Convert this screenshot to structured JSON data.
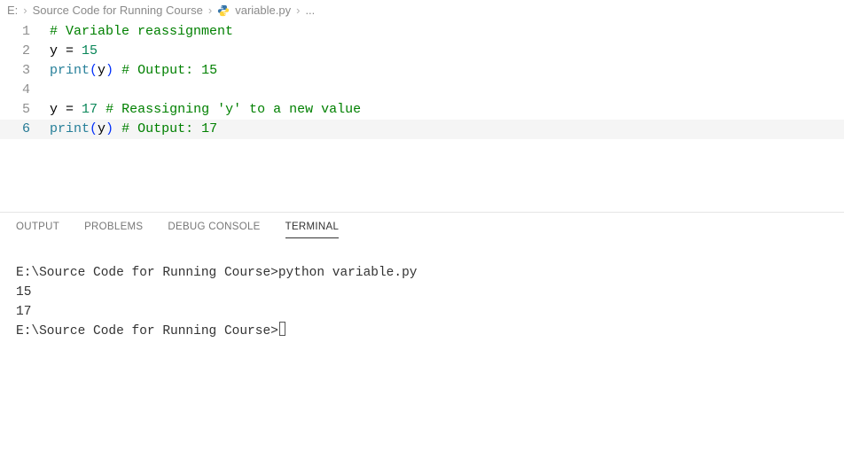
{
  "breadcrumb": {
    "root": "E:",
    "folder": "Source Code for Running Course",
    "file": "variable.py",
    "tail": "..."
  },
  "code": {
    "lines": [
      {
        "n": "1",
        "tokens": [
          [
            "comment",
            "# Variable reassignment"
          ]
        ]
      },
      {
        "n": "2",
        "tokens": [
          [
            "id",
            "y"
          ],
          [
            "op",
            " = "
          ],
          [
            "num",
            "15"
          ]
        ]
      },
      {
        "n": "3",
        "tokens": [
          [
            "func",
            "print"
          ],
          [
            "paren",
            "("
          ],
          [
            "id",
            "y"
          ],
          [
            "paren",
            ")"
          ],
          [
            "op",
            " "
          ],
          [
            "comment",
            "# Output: 15"
          ]
        ]
      },
      {
        "n": "4",
        "tokens": []
      },
      {
        "n": "5",
        "tokens": [
          [
            "id",
            "y"
          ],
          [
            "op",
            " = "
          ],
          [
            "num",
            "17"
          ],
          [
            "op",
            " "
          ],
          [
            "comment",
            "# Reassigning 'y' to a new value"
          ]
        ]
      },
      {
        "n": "6",
        "tokens": [
          [
            "func",
            "print"
          ],
          [
            "paren",
            "("
          ],
          [
            "id",
            "y"
          ],
          [
            "paren",
            ")"
          ],
          [
            "op",
            " "
          ],
          [
            "comment",
            "# Output: 17"
          ]
        ],
        "active": true
      }
    ]
  },
  "panel": {
    "tabs": [
      "OUTPUT",
      "PROBLEMS",
      "DEBUG CONSOLE",
      "TERMINAL"
    ],
    "active": "TERMINAL"
  },
  "terminal": {
    "lines": [
      "",
      "E:\\Source Code for Running Course>python variable.py",
      "15",
      "17",
      "",
      "E:\\Source Code for Running Course>"
    ]
  }
}
